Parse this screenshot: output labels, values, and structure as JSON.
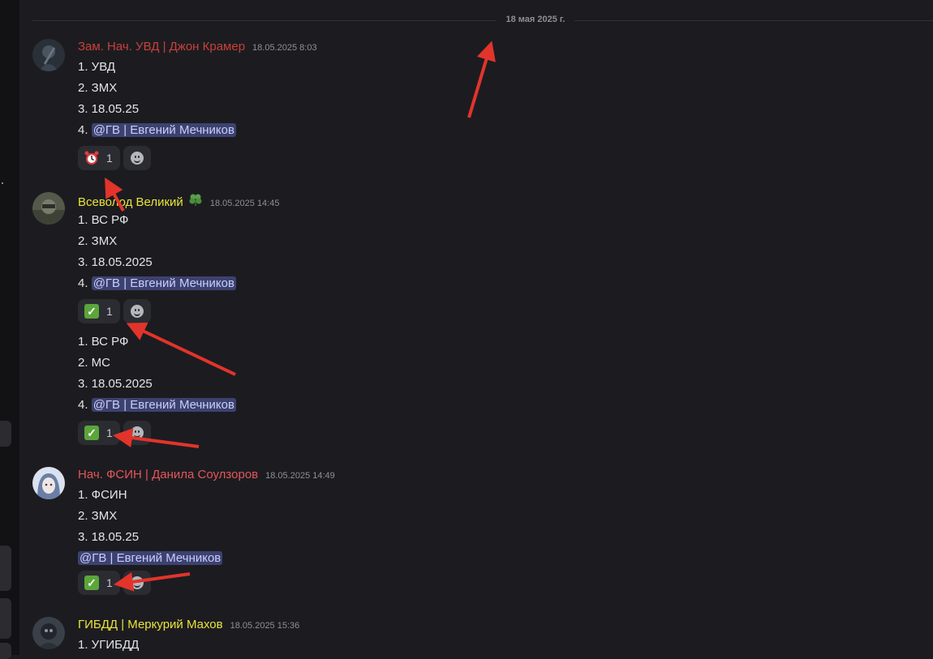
{
  "divider": {
    "date": "18 мая 2025 г."
  },
  "messages": [
    {
      "author": "Зам. Нач. УВД | Джон Крамер",
      "author_color": "#c9403c",
      "timestamp": "18.05.2025 8:03",
      "lines": [
        "1. УВД",
        "2. ЗМХ",
        "3. 18.05.25"
      ],
      "mention_prefix": "4.",
      "mention": "@ГВ | Евгений Мечников",
      "reaction": {
        "emoji": "alarm-clock-icon",
        "count": "1"
      }
    },
    {
      "author": "Всеволод Великий",
      "author_color": "#e9e33a",
      "badge": "clover-icon",
      "timestamp": "18.05.2025 14:45",
      "lines": [
        "1. ВС РФ",
        "2. ЗМХ",
        "3. 18.05.2025"
      ],
      "mention_prefix": "4.",
      "mention": "@ГВ | Евгений Мечников",
      "reaction": {
        "emoji": "check-icon",
        "count": "1"
      }
    },
    {
      "continuation": true,
      "lines": [
        "1. ВС РФ",
        "2. МС",
        "3. 18.05.2025"
      ],
      "mention_prefix": "4.",
      "mention": "@ГВ | Евгений Мечников",
      "reaction": {
        "emoji": "check-icon",
        "count": "1"
      }
    },
    {
      "author": "Нач. ФСИН | Данила Соулзоров",
      "author_color": "#e4555a",
      "timestamp": "18.05.2025 14:49",
      "lines": [
        "1. ФСИН",
        "2. ЗМХ",
        "3. 18.05.25"
      ],
      "mention": "@ГВ | Евгений Мечников",
      "reaction": {
        "emoji": "check-icon",
        "count": "1"
      }
    },
    {
      "author": "ГИБДД | Меркурий Махов",
      "author_color": "#e9e33a",
      "timestamp": "18.05.2025 15:36",
      "lines": [
        "1. УГИБДД"
      ]
    }
  ],
  "colors": {
    "background": "#1c1c20",
    "mention_bg": "#3c4270",
    "arrow": "#e2342b",
    "check": "#5ba53a"
  }
}
